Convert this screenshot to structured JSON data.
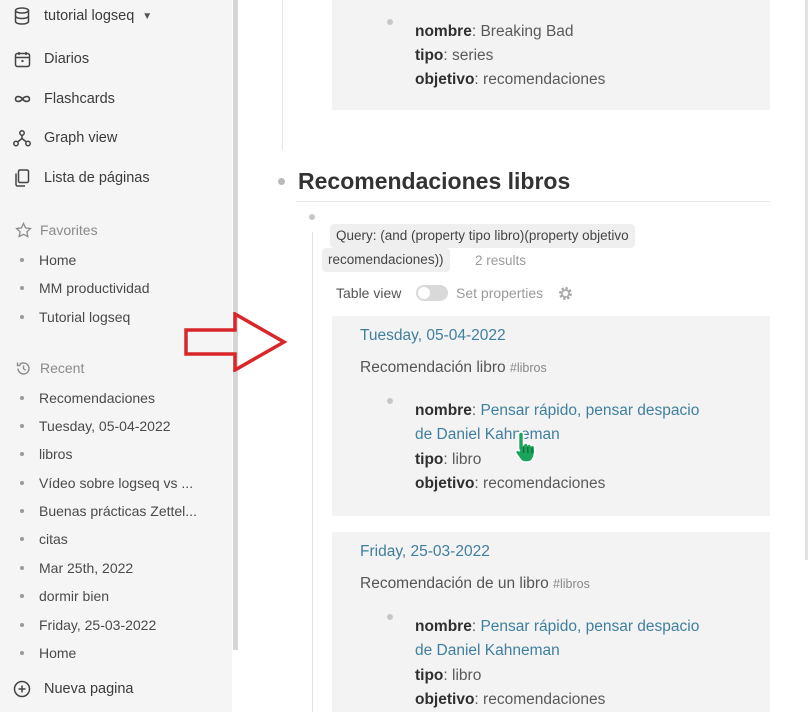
{
  "sidebar": {
    "graph_name": "tutorial logseq",
    "nav": [
      {
        "label": "Diarios",
        "icon": "calendar-icon"
      },
      {
        "label": "Flashcards",
        "icon": "infinity-icon"
      },
      {
        "label": "Graph view",
        "icon": "graph-icon"
      },
      {
        "label": "Lista de páginas",
        "icon": "pages-icon"
      }
    ],
    "favorites_label": "Favorites",
    "favorites": [
      "Home",
      "MM productividad",
      "Tutorial logseq"
    ],
    "recent_label": "Recent",
    "recent": [
      "Recomendaciones",
      "Tuesday, 05-04-2022",
      "libros",
      "Vídeo sobre logseq vs ...",
      "Buenas prácticas Zettel...",
      "citas",
      "Mar 25th, 2022",
      "dormir bien",
      "Friday, 25-03-2022",
      "Home"
    ],
    "new_page": "Nueva pagina"
  },
  "top_card": {
    "nombre_key": "nombre",
    "nombre_val": "Breaking Bad",
    "tipo_key": "tipo",
    "tipo_val": "series",
    "objetivo_key": "objetivo",
    "objetivo_val": "recomendaciones"
  },
  "section": {
    "title": "Recomendaciones libros",
    "query_line1": "Query: (and (property tipo libro)(property objetivo",
    "query_line2": "recomendaciones))",
    "results": "2 results",
    "table_view": "Table view",
    "set_properties": "Set properties"
  },
  "results": [
    {
      "date": "Tuesday, 05-04-2022",
      "text": "Recomendación libro",
      "tag": "#libros",
      "nombre_key": "nombre",
      "nombre_val_1": "Pensar rápido, pensar despacio",
      "nombre_val_2": "de Daniel Kahneman",
      "tipo_key": "tipo",
      "tipo_val": "libro",
      "objetivo_key": "objetivo",
      "objetivo_val": "recomendaciones"
    },
    {
      "date": "Friday, 25-03-2022",
      "text": "Recomendación de un libro",
      "tag": "#libros",
      "nombre_key": "nombre",
      "nombre_val_1": "Pensar rápido, pensar despacio",
      "nombre_val_2": "de Daniel Kahneman",
      "tipo_key": "tipo",
      "tipo_val": "libro",
      "objetivo_key": "objetivo",
      "objetivo_val": "recomendaciones"
    }
  ],
  "colors": {
    "link": "#3f7f9f",
    "arrow": "#d9262a",
    "cursor": "#1aa35a"
  }
}
